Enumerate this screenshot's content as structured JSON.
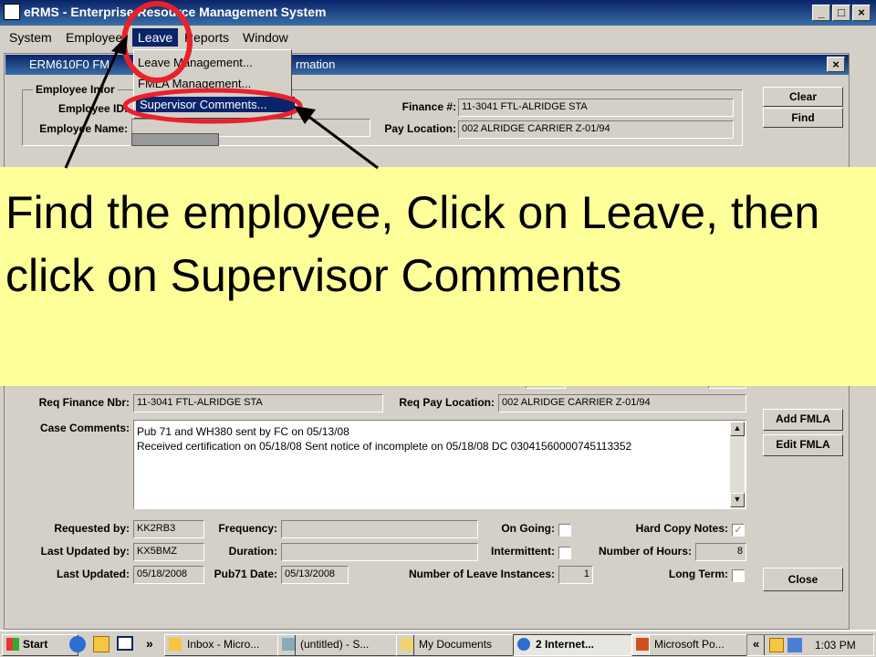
{
  "window": {
    "title": "eRMS - Enterprise Resource Management System",
    "controls": [
      "_",
      "□",
      "×"
    ]
  },
  "menubar": {
    "items": [
      "System",
      "Employee",
      "Leave",
      "Reports",
      "Window"
    ]
  },
  "leave_menu": {
    "items": [
      "Leave Management...",
      "FMLA Management...",
      "Supervisor Comments..."
    ]
  },
  "child_window": {
    "title_left": "ERM610F0 FM",
    "title_right": "rmation",
    "close": "×"
  },
  "employee_info": {
    "group_label": "Employee Infor",
    "id_label": "Employee ID:",
    "name_label": "Employee Name:",
    "finance_label": "Finance #:",
    "finance_value": "11-3041 FTL-ALRIDGE STA",
    "payloc_label": "Pay Location:",
    "payloc_value": "002 ALRIDGE CARRIER Z-01/94"
  },
  "buttons": {
    "clear": "Clear",
    "find": "Find",
    "add_fmla": "Add FMLA",
    "edit_fmla": "Edit FMLA",
    "close": "Close"
  },
  "callout": {
    "text": "Find the employee, Click on Leave, then click on Supervisor Comments"
  },
  "request": {
    "req_finance_label": "Req Finance Nbr:",
    "req_finance_value": "11-3041 FTL-ALRIDGE STA",
    "req_payloc_label": "Req Pay Location:",
    "req_payloc_value": "002 ALRIDGE CARRIER Z-01/94",
    "case_comments_label": "Case Comments:",
    "case_comments_lines": [
      "Pub 71 and WH380 sent by FC on 05/13/08",
      "Received certification on 05/18/08 Sent notice of incomplete on 05/18/08 DC 03041560000745113352"
    ]
  },
  "details": {
    "requested_by_label": "Requested by:",
    "requested_by": "KK2RB3",
    "last_updated_by_label": "Last Updated by:",
    "last_updated_by": "KX5BMZ",
    "last_updated_label": "Last Updated:",
    "last_updated": "05/18/2008",
    "frequency_label": "Frequency:",
    "duration_label": "Duration:",
    "pub71_label": "Pub71 Date:",
    "pub71_date": "05/13/2008",
    "ongoing_label": "On Going:",
    "intermittent_label": "Intermittent:",
    "instances_label": "Number of Leave Instances:",
    "instances": "1",
    "hardcopy_label": "Hard Copy Notes:",
    "hours_label": "Number of Hours:",
    "hours": "8",
    "longterm_label": "Long Term:"
  },
  "taskbar": {
    "start": "Start",
    "chevron": "»",
    "tasks": [
      "Inbox - Micro...",
      "(untitled) - S...",
      "My Documents",
      "2 Internet...",
      "Microsoft Po..."
    ],
    "tray_chevron": "«",
    "clock": "1:03 PM"
  },
  "colors": {
    "highlight_ring": "#e8212b",
    "callout_bg": "#ffff99",
    "titlebar": "#0a246a"
  }
}
